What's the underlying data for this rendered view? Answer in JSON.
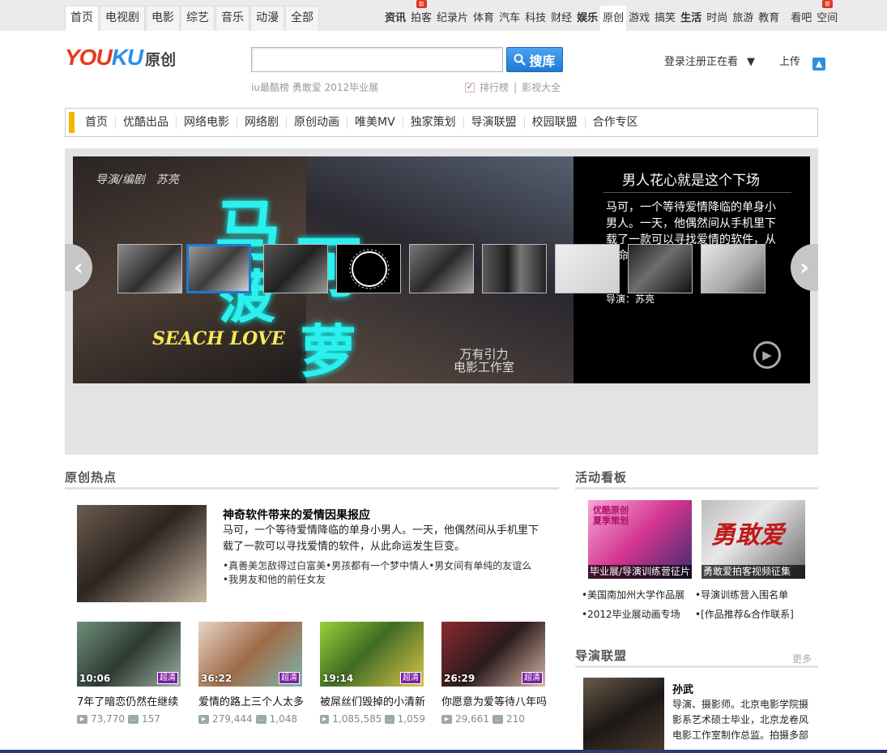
{
  "topbar": {
    "left_items": [
      "首页",
      "电视剧",
      "电影",
      "综艺",
      "音乐",
      "动漫",
      "全部"
    ],
    "right_items": [
      {
        "label": "资讯",
        "bold": true
      },
      {
        "label": "拍客",
        "new": true
      },
      {
        "label": "纪录片"
      },
      {
        "label": "体育"
      },
      {
        "label": "汽车"
      },
      {
        "label": "科技"
      },
      {
        "label": "财经"
      },
      {
        "label": "娱乐",
        "bold": true
      },
      {
        "label": "原创",
        "active": true
      },
      {
        "label": "游戏"
      },
      {
        "label": "搞笑"
      },
      {
        "label": "生活",
        "bold": true
      },
      {
        "label": "时尚"
      },
      {
        "label": "旅游"
      },
      {
        "label": "教育"
      },
      {
        "label": "看吧"
      },
      {
        "label": "空间",
        "new": true
      }
    ],
    "new_badge": "新"
  },
  "header": {
    "logo_you": "YOU",
    "logo_ku": "KU",
    "logo_section": "原创",
    "search_value": "",
    "search_button": "搜库",
    "hot_words": [
      "iu最酷榜",
      "勇敢爱",
      "2012毕业展"
    ],
    "ranking_link": "排行榜",
    "sep": "|",
    "video_link": "影视大全",
    "login": "登录",
    "register": "注册",
    "watching": "正在看",
    "upload": "上传"
  },
  "nav": {
    "items": [
      "首页",
      "优酷出品",
      "网络电影",
      "网络剧",
      "原创动画",
      "唯美MV",
      "独家策划",
      "导演联盟",
      "校园联盟",
      "合作专区"
    ]
  },
  "banner": {
    "credit": "导演/编剧　苏亮",
    "poster_chars": [
      "马",
      "可",
      "菠",
      "萝"
    ],
    "english_title": "SEACH LOVE",
    "studio_line1": "万有引力",
    "studio_line2": "电影工作室",
    "title": "男人花心就是这个下场",
    "description": "马可，一个等待爱情降临的单身小男人。一天，他偶然间从手机里下载了一款可以寻找爱情的软件，从此命运发生巨变。",
    "director": "导演：苏亮"
  },
  "hot": {
    "section_title": "原创热点",
    "feature_title": "神奇软件带来的爱情因果报应",
    "feature_desc": "马可，一个等待爱情降临的单身小男人。一天，他偶然间从手机里下载了一款可以寻找爱情的软件，从此命运发生巨变。",
    "feature_links": [
      "•真善美怎敌得过白富美",
      "•男孩都有一个梦中情人",
      "•男女间有单纯的友谊么",
      "•我男友和他的前任女友"
    ],
    "videos": [
      {
        "duration": "10:06",
        "hd": "超清",
        "title": "7年了暗恋仍然在继续",
        "plays": "73,770",
        "comments": "157"
      },
      {
        "duration": "36:22",
        "hd": "超清",
        "title": "爱情的路上三个人太多",
        "plays": "279,444",
        "comments": "1,048"
      },
      {
        "duration": "19:14",
        "hd": "超清",
        "title": "被屌丝们毁掉的小清新",
        "plays": "1,085,585",
        "comments": "1,059"
      },
      {
        "duration": "26:29",
        "hd": "超清",
        "title": "你愿意为爱等待八年吗",
        "plays": "29,661",
        "comments": "210"
      }
    ]
  },
  "activity": {
    "section_title": "活动看板",
    "img1_caption": "毕业展/导演训练营征片",
    "img1_text": "优酷原创\n夏季策划",
    "img2_caption": "勇敢爱拍客视频征集",
    "img2_text": "勇敢爱",
    "links": [
      "•美国南加州大学作品展",
      "•导演训练营入围名单",
      "•2012毕业展动画专场",
      "•[作品推荐&合作联系]"
    ]
  },
  "directors": {
    "section_title": "导演联盟",
    "more": "更多",
    "name": "孙武",
    "desc": "导演、摄影师。北京电影学院摄影系艺术硕士毕业，北京龙卷风电影工作室制作总监。拍摄多部"
  },
  "colors": {
    "accent_blue": "#1f7ad6",
    "youku_red": "#e8381d",
    "youku_blue": "#2c8fe8",
    "nav_mark": "#f5b400",
    "hd_purple": "#7a1fa2",
    "poster_cyan": "#2cf0ee"
  }
}
